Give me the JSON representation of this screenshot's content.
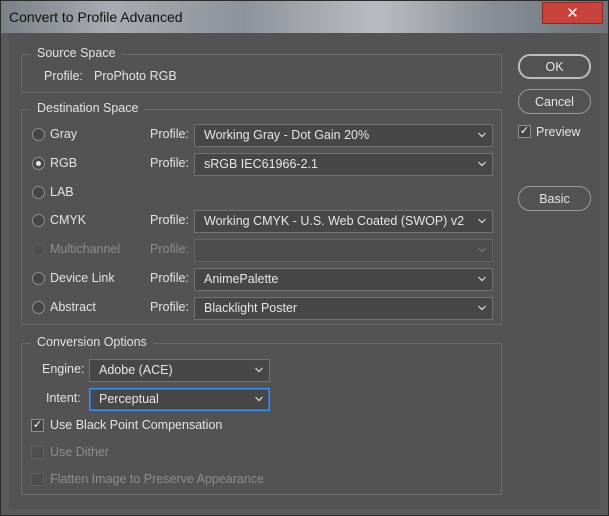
{
  "window": {
    "title": "Convert to Profile Advanced",
    "close_glyph": "✕"
  },
  "source_space": {
    "title": "Source Space",
    "profile_label": "Profile:",
    "profile_value": "ProPhoto RGB"
  },
  "destination_space": {
    "title": "Destination Space",
    "profile_label": "Profile:",
    "rows": [
      {
        "label": "Gray",
        "checked": false,
        "disabled": false,
        "profile": "Working Gray - Dot Gain 20%",
        "has_profile": true
      },
      {
        "label": "RGB",
        "checked": true,
        "disabled": false,
        "profile": "sRGB IEC61966-2.1",
        "has_profile": true
      },
      {
        "label": "LAB",
        "checked": false,
        "disabled": false,
        "profile": "",
        "has_profile": false
      },
      {
        "label": "CMYK",
        "checked": false,
        "disabled": false,
        "profile": "Working CMYK - U.S. Web Coated (SWOP) v2",
        "has_profile": true
      },
      {
        "label": "Multichannel",
        "checked": false,
        "disabled": true,
        "profile": "",
        "has_profile": true
      },
      {
        "label": "Device Link",
        "checked": false,
        "disabled": false,
        "profile": "AnimePalette",
        "has_profile": true
      },
      {
        "label": "Abstract",
        "checked": false,
        "disabled": false,
        "profile": "Blacklight Poster",
        "has_profile": true
      }
    ]
  },
  "conversion_options": {
    "title": "Conversion Options",
    "engine_label": "Engine:",
    "engine_value": "Adobe (ACE)",
    "intent_label": "Intent:",
    "intent_value": "Perceptual",
    "black_point_label": "Use Black Point Compensation",
    "black_point_checked": true,
    "dither_label": "Use Dither",
    "dither_checked": false,
    "flatten_label": "Flatten Image to Preserve Appearance",
    "flatten_checked": false
  },
  "buttons": {
    "ok": "OK",
    "cancel": "Cancel",
    "preview": "Preview",
    "preview_checked": true,
    "basic": "Basic"
  },
  "colors": {
    "dialog_bg": "#535353",
    "focus_border": "#3e8ff0",
    "close_button": "#c7433b"
  },
  "icons": {
    "close": "close-icon",
    "dropdown": "chevron-down-icon",
    "check": "check-icon"
  }
}
